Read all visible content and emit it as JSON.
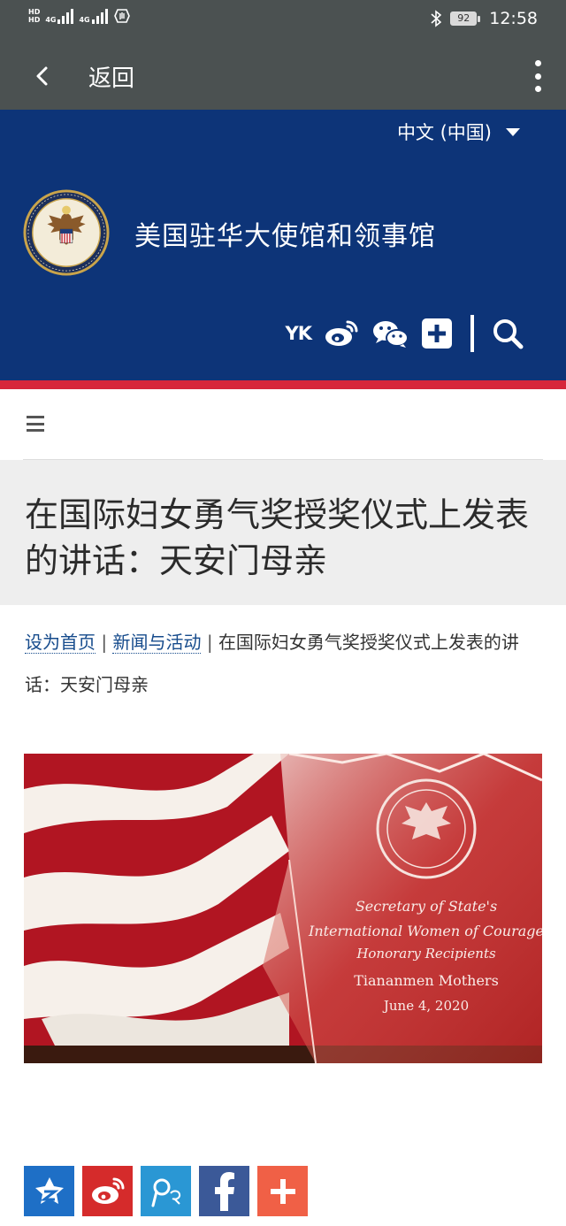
{
  "status_bar": {
    "hd_labels": [
      "HD",
      "HD"
    ],
    "network_labels": [
      "4G",
      "4G"
    ],
    "battery": "92",
    "time": "12:58"
  },
  "app_bar": {
    "back_label": "返回"
  },
  "header": {
    "language": "中文 (中国)",
    "site_title": "美国驻华大使馆和领事馆",
    "youku_label": "YK",
    "colors": {
      "background": "#0d3478",
      "stripe": "#d7263a"
    }
  },
  "article": {
    "title": "在国际妇女勇气奖授奖仪式上发表的讲话：天安门母亲",
    "breadcrumb": {
      "home": "设为首页",
      "section": "新闻与活动",
      "separator": "|",
      "current": "在国际妇女勇气奖授奖仪式上发表的讲话：天安门母亲"
    }
  },
  "hero_image": {
    "plaque_lines": [
      "Secretary of State's",
      "International Women of Courage",
      "Honorary Recipients",
      "Tiananmen Mothers",
      "June 4, 2020"
    ]
  },
  "share_buttons": [
    {
      "icon": "qzone-icon",
      "color": "#1e6fc6"
    },
    {
      "icon": "weibo-icon",
      "color": "#d52b2b"
    },
    {
      "icon": "tencent-weibo-icon",
      "color": "#2a97d4"
    },
    {
      "icon": "facebook-icon",
      "color": "#3b5998"
    },
    {
      "icon": "addthis-plus-icon",
      "color": "#f06046"
    }
  ]
}
